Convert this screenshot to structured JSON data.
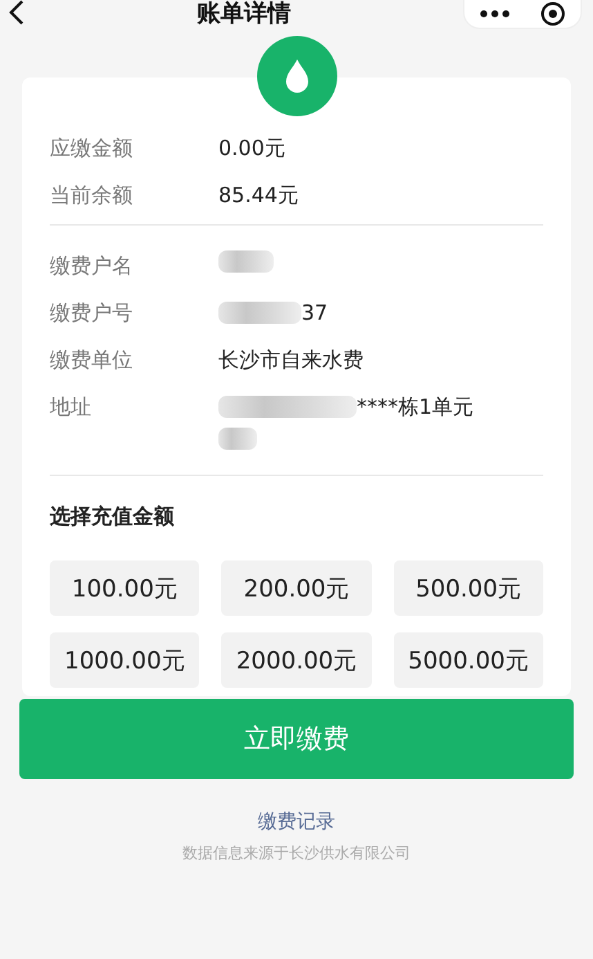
{
  "nav": {
    "title": "账单详情"
  },
  "bill": [
    {
      "label": "应缴金额",
      "value": "0.00元"
    },
    {
      "label": "当前余额",
      "value": "85.44元"
    }
  ],
  "account": [
    {
      "label": "缴费户名",
      "redacted": true
    },
    {
      "label": "缴费户号",
      "redacted": true,
      "value": "37"
    },
    {
      "label": "缴费单位",
      "redacted": false,
      "value": "长沙市自来水费"
    },
    {
      "label": "地址",
      "redacted": true,
      "value": "****栋1单元"
    }
  ],
  "recharge": {
    "title": "选择充值金额",
    "options": [
      {
        "label": "100.00元",
        "selected": false
      },
      {
        "label": "200.00元",
        "selected": false
      },
      {
        "label": "500.00元",
        "selected": false
      },
      {
        "label": "1000.00元",
        "selected": false
      },
      {
        "label": "2000.00元",
        "selected": false
      },
      {
        "label": "5000.00元",
        "selected": false
      }
    ]
  },
  "pay_button": "立即缴费",
  "records_link": "缴费记录",
  "source_note": "数据信息来源于长沙供水有限公司"
}
